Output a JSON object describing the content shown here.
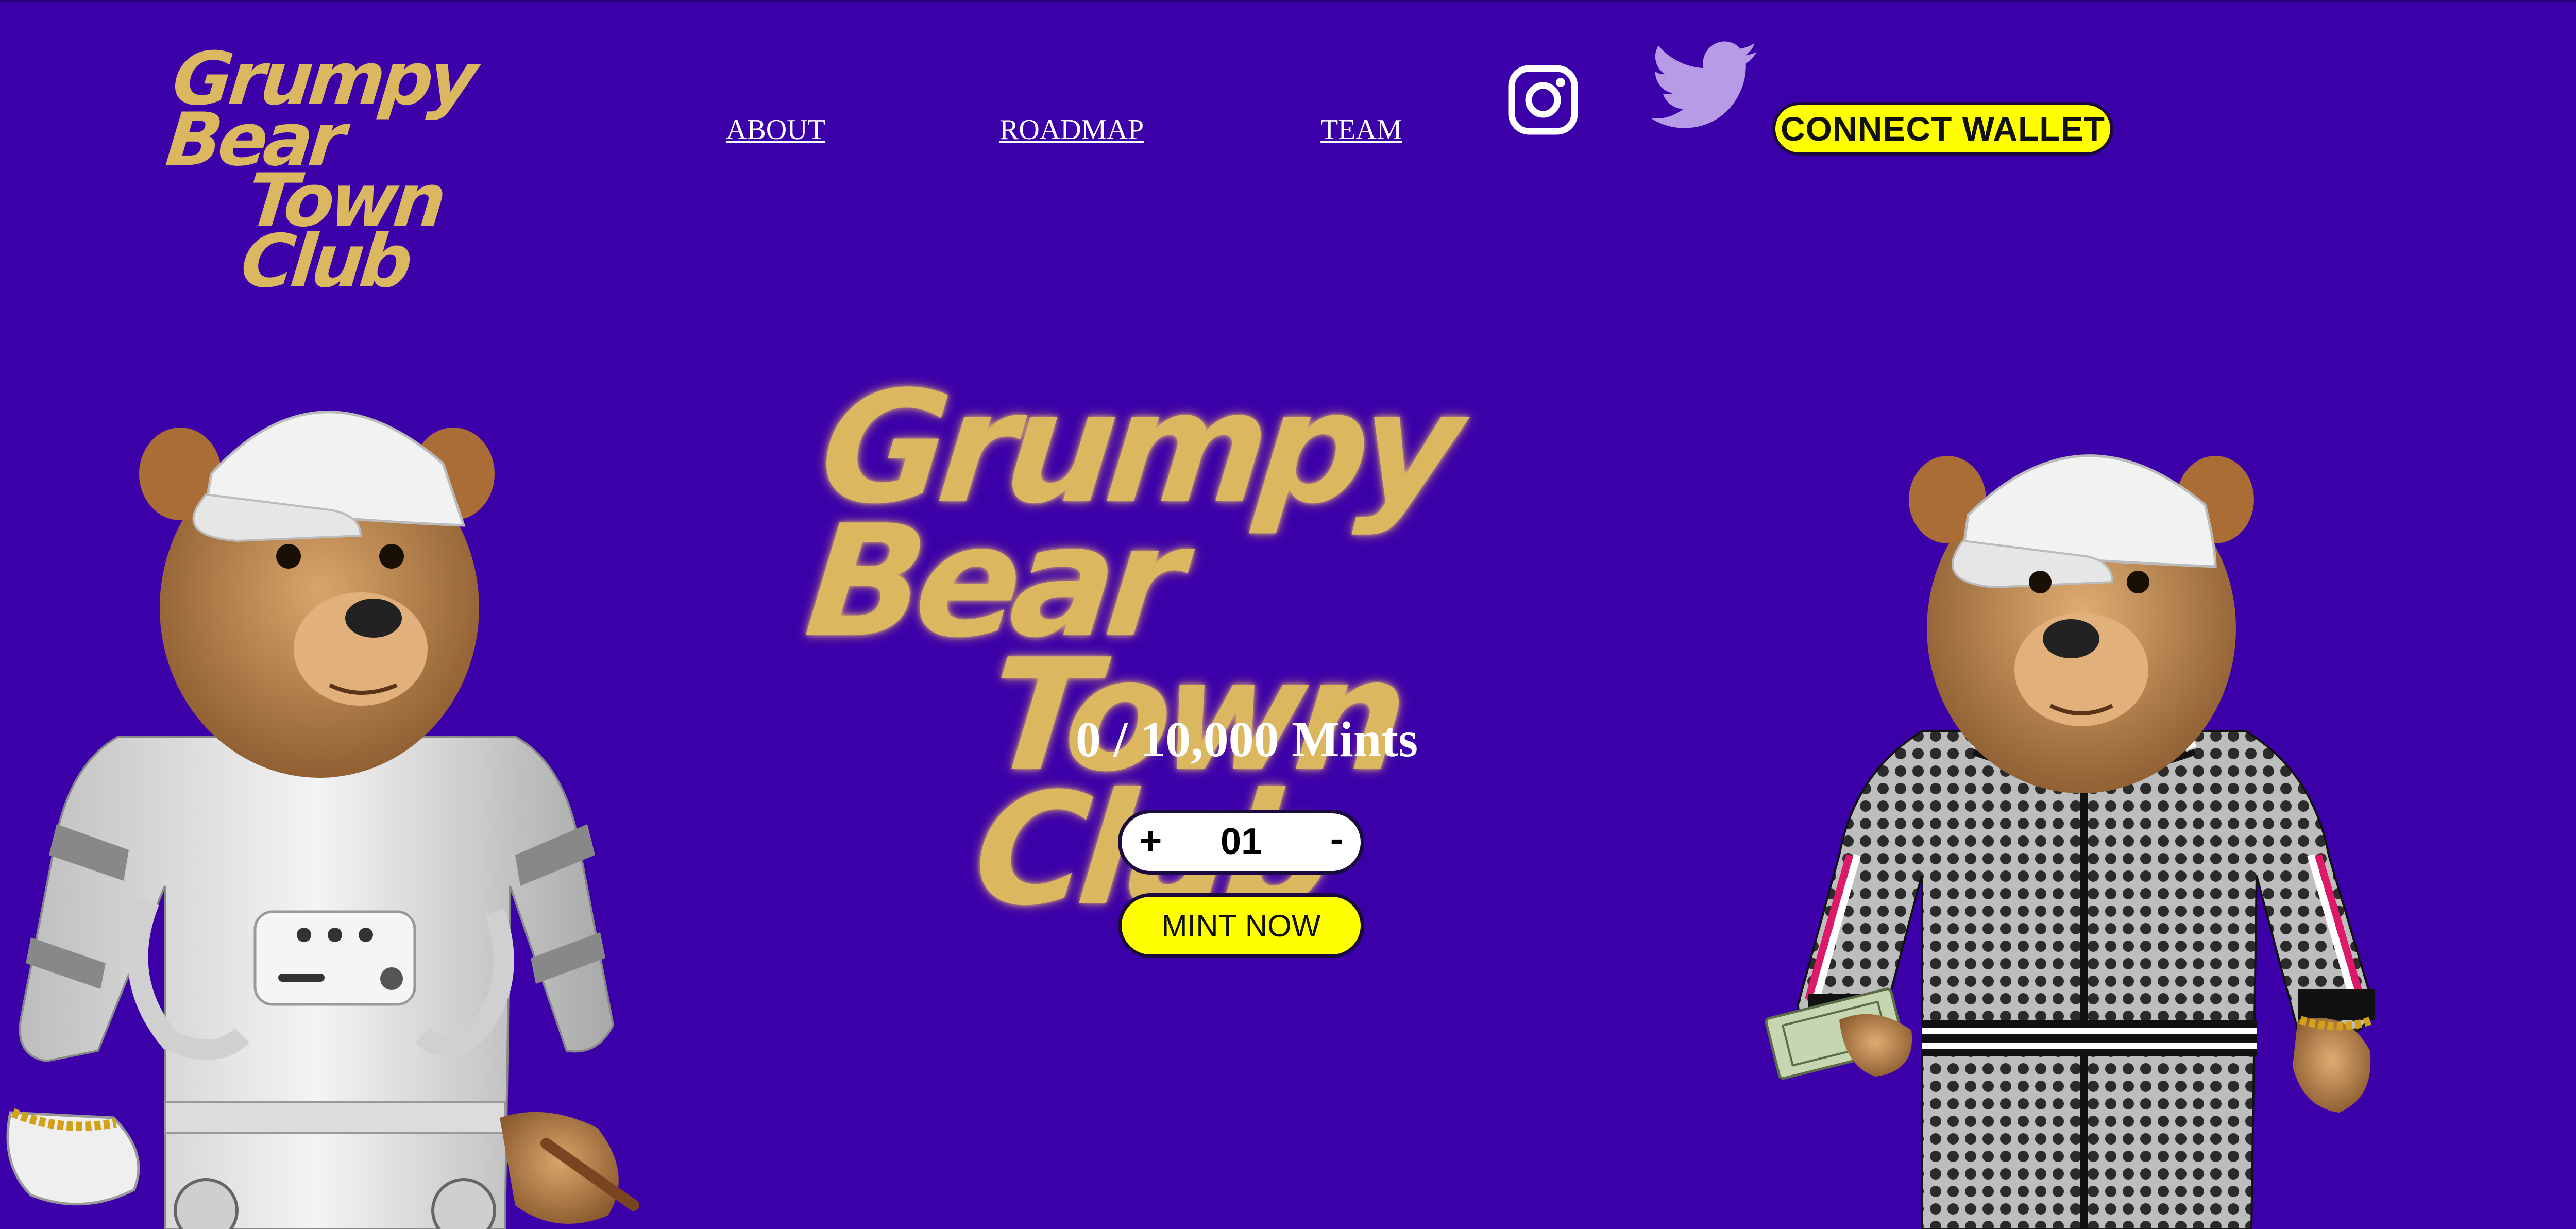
{
  "header": {
    "logo_line1": "Grumpy Bear",
    "logo_line2": "Town Club",
    "nav": [
      {
        "label": "ABOUT"
      },
      {
        "label": "ROADMAP"
      },
      {
        "label": "TEAM"
      }
    ],
    "social_icons": [
      "instagram-icon",
      "twitter-icon"
    ],
    "connect_label": "CONNECT WALLET"
  },
  "hero": {
    "logo_line1": "Grumpy Bear",
    "logo_line2": "Town Club",
    "mint_count": "0 / 10,000 Mints",
    "quantity": {
      "plus": "+",
      "value": "01",
      "minus": "-"
    },
    "mint_label": "MINT NOW"
  },
  "colors": {
    "background": "#3c00a9",
    "gold": "#dbb860",
    "button_yellow": "#ffff00",
    "twitter_lavender": "#b79be6"
  }
}
